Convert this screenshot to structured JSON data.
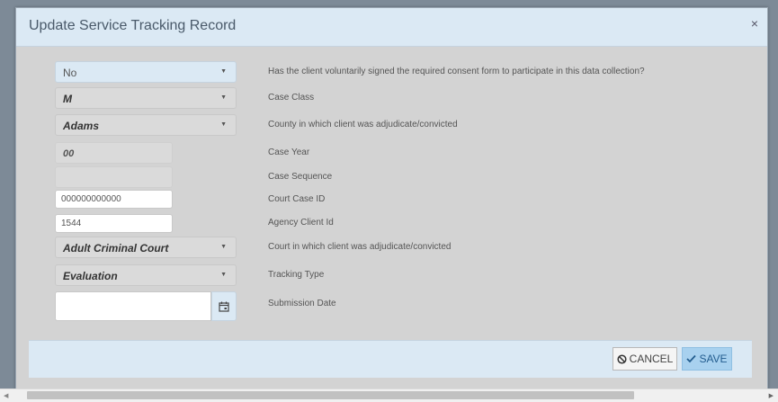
{
  "modal": {
    "title": "Update Service Tracking Record",
    "close_symbol": "×"
  },
  "form": {
    "consent": {
      "value": "No",
      "label": "Has the client voluntarily signed the required consent form to participate in this data collection?"
    },
    "case_class": {
      "value": "M",
      "label": "Case Class"
    },
    "county": {
      "value": "Adams",
      "label": "County in which client was adjudicate/convicted"
    },
    "case_year": {
      "value": "00",
      "label": "Case Year"
    },
    "case_sequence": {
      "value": "",
      "label": "Case Sequence"
    },
    "court_case_id": {
      "value": "000000000000",
      "label": "Court Case ID"
    },
    "agency_client_id": {
      "value": "1544",
      "label": "Agency Client Id"
    },
    "court": {
      "value": "Adult Criminal Court",
      "label": "Court in which client was adjudicate/convicted"
    },
    "tracking_type": {
      "value": "Evaluation",
      "label": "Tracking Type"
    },
    "submission_date": {
      "value": "",
      "label": "Submission Date"
    }
  },
  "footer": {
    "cancel_label": "CANCEL",
    "save_label": "SAVE"
  },
  "icons": {
    "caret": "▼",
    "calendar": "calendar-icon",
    "cancel": "ban-icon",
    "save": "check-icon",
    "scroll_left": "◀",
    "scroll_right": "▶"
  },
  "colors": {
    "header_bg": "#dbe9f4",
    "body_bg": "#d3d3d3",
    "save_bg": "#a8d1ef",
    "save_text": "#235d8f"
  }
}
